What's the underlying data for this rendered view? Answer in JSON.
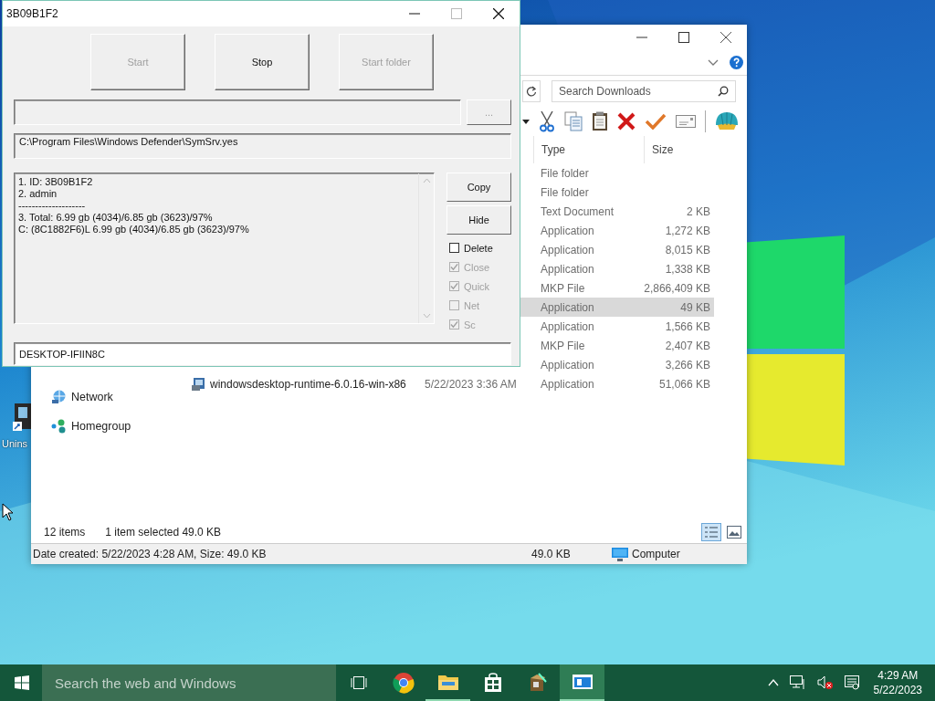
{
  "explorer": {
    "search": {
      "placeholder": "Search Downloads"
    },
    "columns": [
      "Type",
      "Size"
    ],
    "files": [
      {
        "type": "File folder",
        "selected": false
      },
      {
        "type": "File folder",
        "selected": false
      },
      {
        "type": "Text Document",
        "size": "2 KB",
        "selected": false
      },
      {
        "type": "Application",
        "size": "1,272 KB",
        "selected": false
      },
      {
        "type": "Application",
        "size": "8,015 KB",
        "selected": false
      },
      {
        "type": "Application",
        "size": "1,338 KB",
        "selected": false
      },
      {
        "type": "MKP File",
        "size": "2,866,409 KB",
        "selected": false
      },
      {
        "type": "Application",
        "size": "49 KB",
        "selected": true
      },
      {
        "type": "Application",
        "size": "1,566 KB",
        "selected": false
      },
      {
        "type": "MKP File",
        "size": "2,407 KB",
        "selected": false
      },
      {
        "type": "Application",
        "size": "3,266 KB",
        "selected": false
      },
      {
        "name": "windowsdesktop-runtime-6.0.16-win-x86",
        "date": "5/22/2023 3:36 AM",
        "type": "Application",
        "size": "51,066 KB",
        "selected": false
      }
    ],
    "sidebar": [
      {
        "label": "Network",
        "kind": "network"
      },
      {
        "label": "Homegroup",
        "kind": "homegroup"
      }
    ],
    "status": {
      "count": "12 items",
      "selection": "1 item selected  49.0 KB"
    },
    "details": {
      "text": "Date created: 5/22/2023 4:28 AM, Size: 49.0 KB",
      "size": "49.0 KB",
      "location": "Computer"
    }
  },
  "dialog": {
    "title": "3B09B1F2",
    "buttons": [
      {
        "label": "Start",
        "disabled": true
      },
      {
        "label": "Stop",
        "disabled": false
      },
      {
        "label": "Start folder",
        "disabled": true
      }
    ],
    "browse_button": {
      "label": "...",
      "disabled": true
    },
    "path": "C:\\Program Files\\Windows Defender\\SymSrv.yes",
    "log_lines": [
      "1. ID: 3B09B1F2",
      "2. admin",
      "--------------------",
      "3. Total: 6.99 gb (4034)/6.85 gb (3623)/97%",
      "C: (8C1882F6)L 6.99 gb (4034)/6.85 gb (3623)/97%"
    ],
    "side_buttons": [
      "Copy",
      "Hide"
    ],
    "options": [
      {
        "label": "Delete",
        "checked": false,
        "disabled": false
      },
      {
        "label": "Close",
        "checked": true,
        "disabled": true
      },
      {
        "label": "Quick",
        "checked": true,
        "disabled": true
      },
      {
        "label": "Net",
        "checked": false,
        "disabled": true
      },
      {
        "label": "Sc",
        "checked": true,
        "disabled": true
      }
    ],
    "computer_name": "DESKTOP-IFIIN8C"
  },
  "desktop_icon": {
    "label": "Unins"
  },
  "taskbar": {
    "search_placeholder": "Search the web and Windows",
    "time": "4:29 AM",
    "date": "5/22/2023"
  }
}
